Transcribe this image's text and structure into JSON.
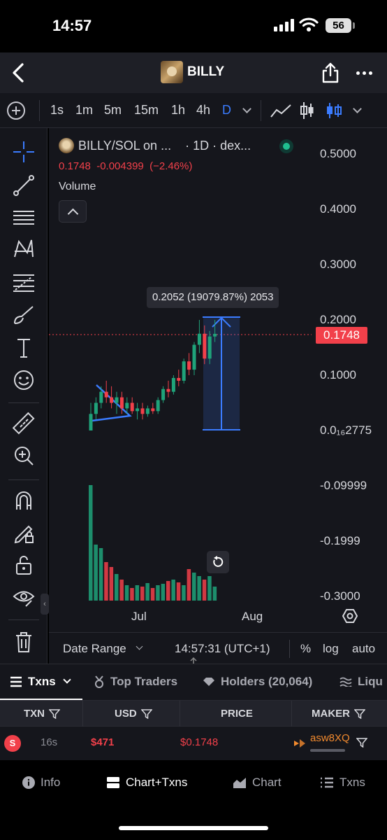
{
  "status_bar": {
    "time": "14:57",
    "battery": "56"
  },
  "header": {
    "title": "BILLY"
  },
  "timeframes": [
    "1s",
    "1m",
    "5m",
    "15m",
    "1h",
    "4h",
    "D"
  ],
  "active_timeframe": "D",
  "chart": {
    "symbol": "BILLY/SOL on ...",
    "interval_source": "· 1D · dex...",
    "quote": "0.1748  -0.004399  (−2.46%)",
    "volume_label": "Volume",
    "price_axis": [
      "0.5000",
      "0.4000",
      "0.3000",
      "0.2000",
      "0.1000",
      "0.0₁₆2775",
      "-0.09999",
      "-0.1999",
      "-0.3000"
    ],
    "last_price": "0.1748",
    "measure_label": "0.2052 (19079.87%) 2053",
    "x_axis": [
      "Jul",
      "Aug"
    ],
    "footer": {
      "date_range": "Date Range",
      "clock": "14:57:31 (UTC+1)",
      "percent": "%",
      "log": "log",
      "auto": "auto"
    }
  },
  "colors": {
    "up": "#1fa37a",
    "down": "#f2404a",
    "accent": "#3b7cff",
    "bg": "#15161c"
  },
  "tx_tabs": [
    {
      "label": "Txns",
      "icon": "list-icon"
    },
    {
      "label": "Top Traders",
      "icon": "medal-icon"
    },
    {
      "label": "Holders (20,064)",
      "icon": "diamond-icon"
    },
    {
      "label": "Liqu",
      "icon": "liquidity-icon"
    }
  ],
  "table": {
    "headers": [
      "TXN",
      "USD",
      "PRICE",
      "MAKER"
    ],
    "rows": [
      {
        "side": "S",
        "age": "16s",
        "usd": "$471",
        "price": "$0.1748",
        "maker": "asw8XQ"
      }
    ]
  },
  "bottom_nav": [
    {
      "label": "Info",
      "icon": "info-icon"
    },
    {
      "label": "Chart+Txns",
      "icon": "chart-txns-icon"
    },
    {
      "label": "Chart",
      "icon": "area-chart-icon"
    },
    {
      "label": "Txns",
      "icon": "list-icon"
    }
  ]
}
